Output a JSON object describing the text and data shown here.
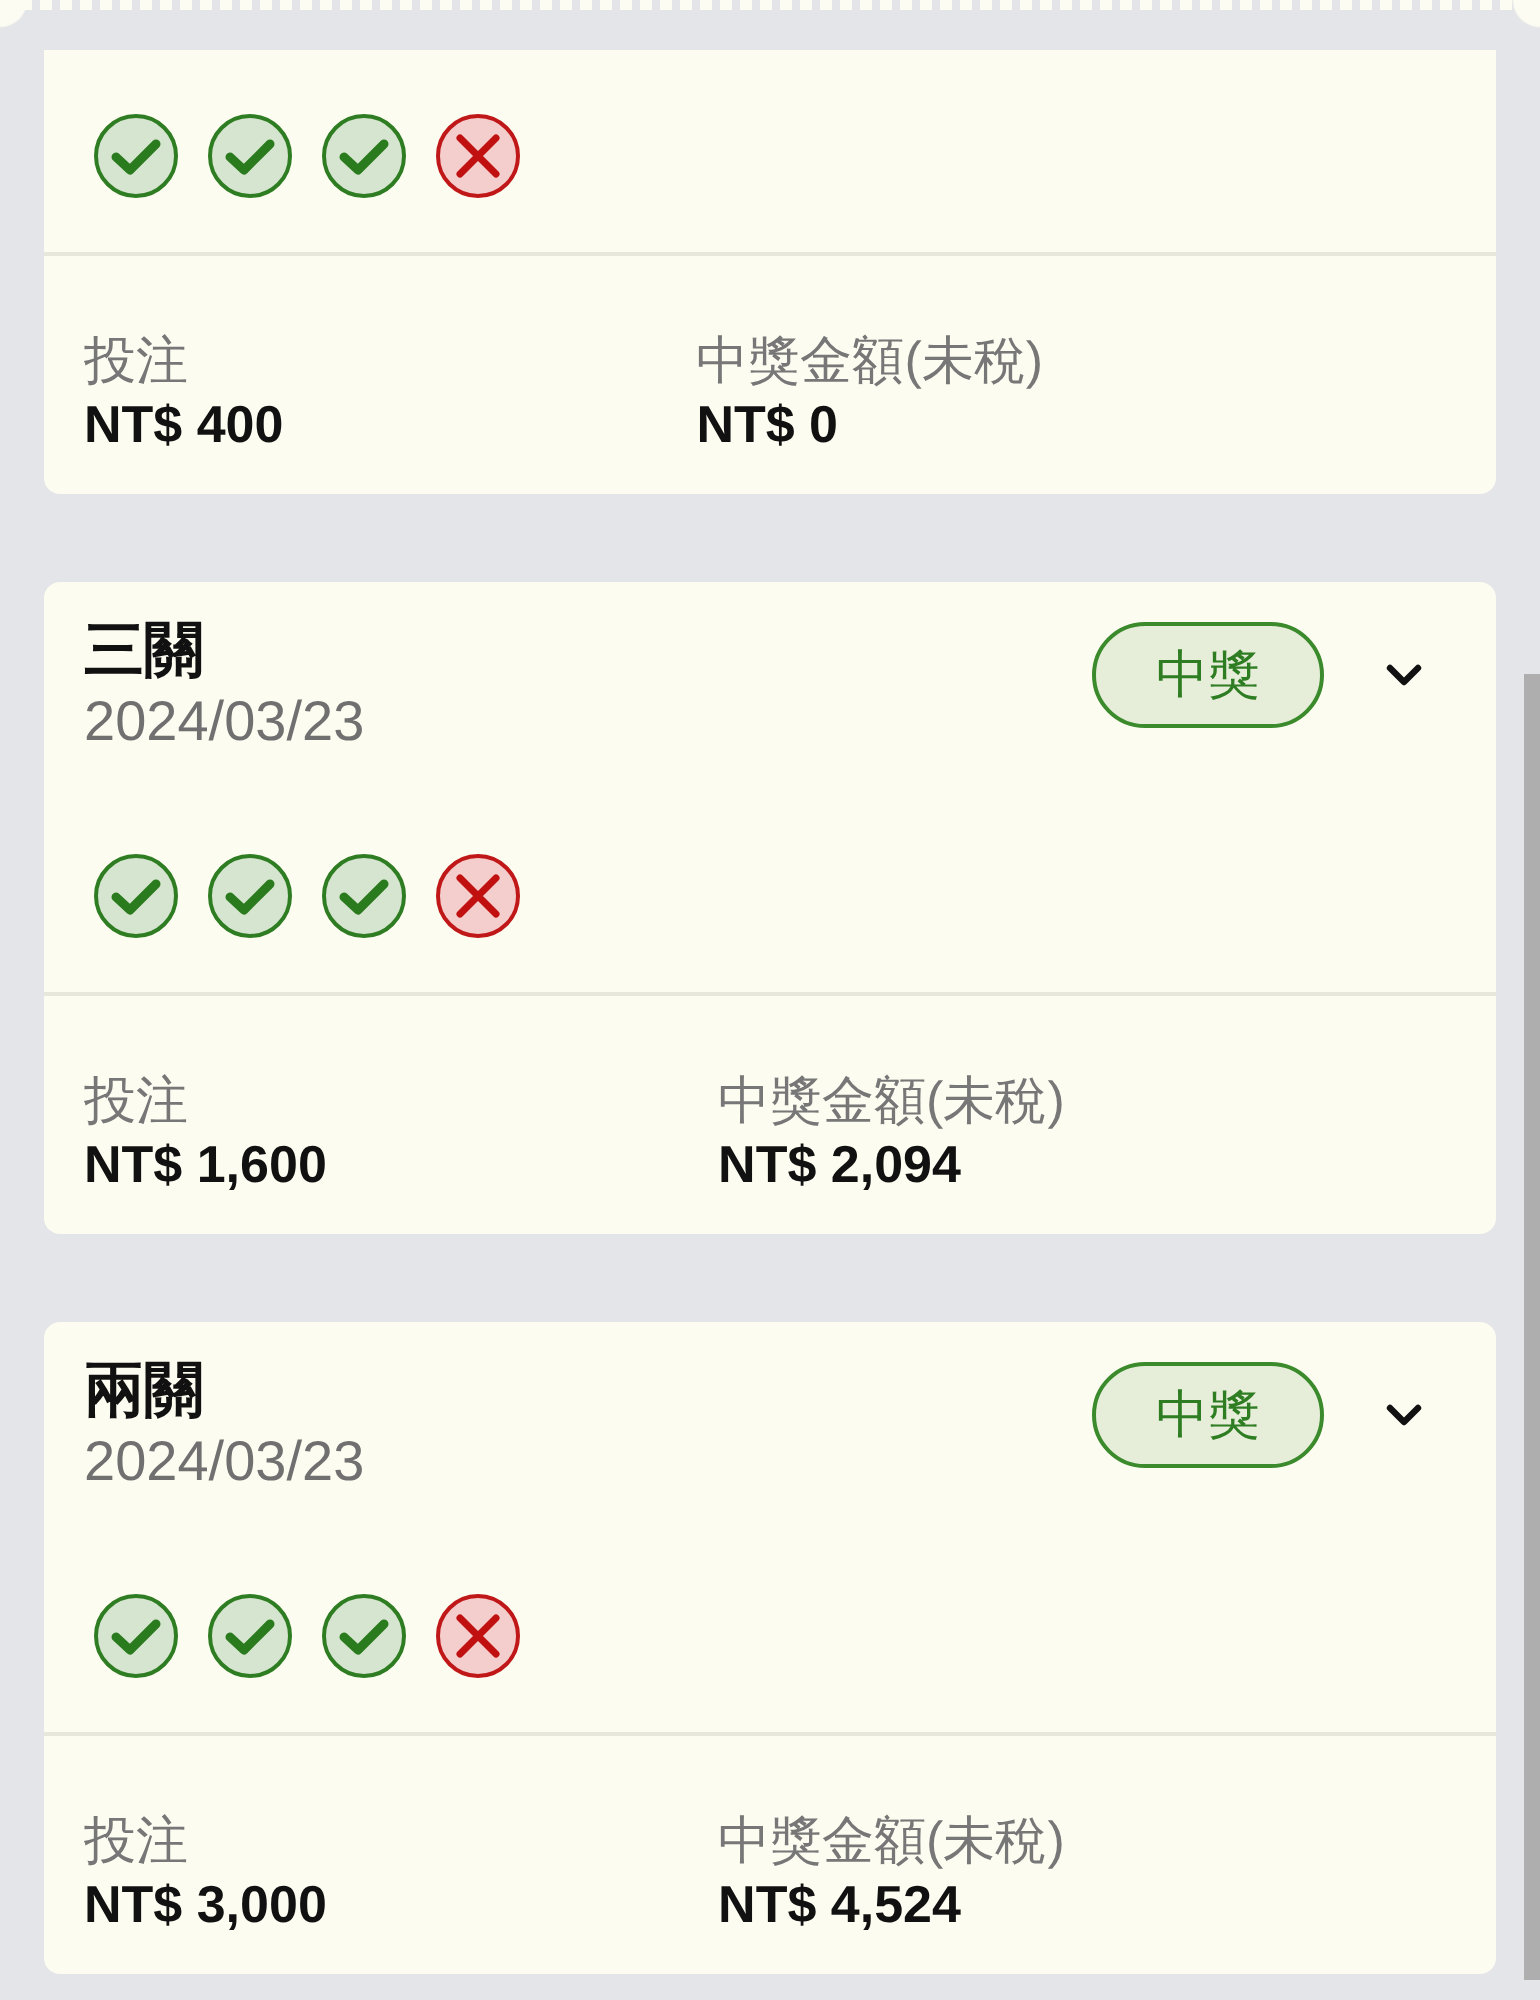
{
  "cards": [
    {
      "legs": [
        {
          "kind": "win"
        },
        {
          "kind": "win"
        },
        {
          "kind": "win"
        },
        {
          "kind": "loss"
        }
      ],
      "stake_label": "投注",
      "stake": "NT$ 400",
      "payout_label": "中獎金額(未稅)",
      "payout": "NT$ 0"
    },
    {
      "title": "三關",
      "date": "2024/03/23",
      "status": {
        "label": "中獎",
        "kind": "won"
      },
      "expanded": false,
      "legs": [
        {
          "kind": "win"
        },
        {
          "kind": "win"
        },
        {
          "kind": "win"
        },
        {
          "kind": "loss"
        }
      ],
      "stake_label": "投注",
      "stake": "NT$ 1,600",
      "payout_label": "中獎金額(未稅)",
      "payout": "NT$ 2,094"
    },
    {
      "title": "兩關",
      "date": "2024/03/23",
      "status": {
        "label": "中獎",
        "kind": "won"
      },
      "expanded": false,
      "legs": [
        {
          "kind": "win"
        },
        {
          "kind": "win"
        },
        {
          "kind": "win"
        },
        {
          "kind": "loss"
        }
      ],
      "stake_label": "投注",
      "stake": "NT$ 3,000",
      "payout_label": "中獎金額(未稅)",
      "payout": "NT$ 4,524"
    }
  ]
}
